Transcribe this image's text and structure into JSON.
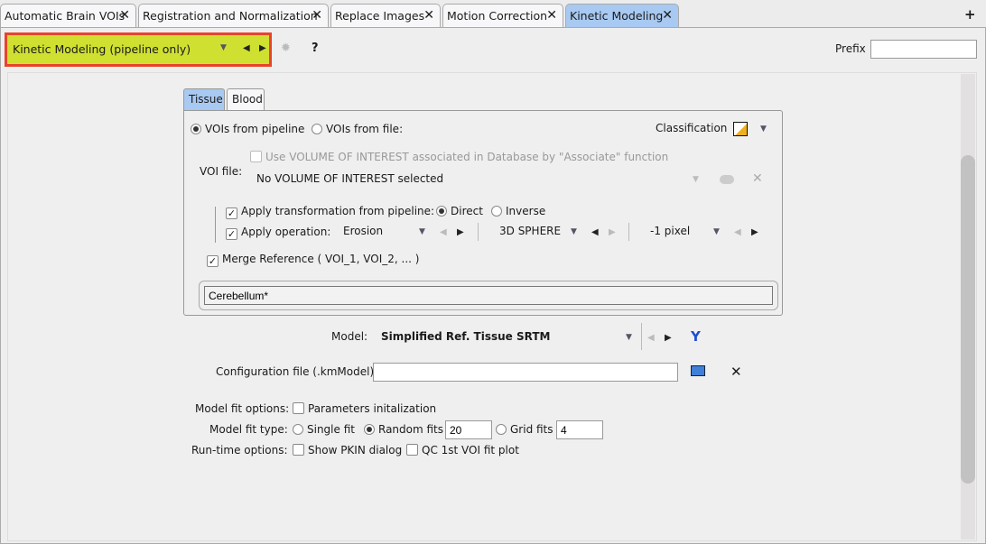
{
  "tabs": [
    {
      "label": "Automatic Brain VOIs",
      "active": false
    },
    {
      "label": "Registration and Normalization",
      "active": false
    },
    {
      "label": "Replace Images",
      "active": false
    },
    {
      "label": "Motion Correction",
      "active": false
    },
    {
      "label": "Kinetic Modeling",
      "active": true
    }
  ],
  "add_tab": "+",
  "toolbar": {
    "pipeline": "Kinetic Modeling (pipeline only)",
    "help": "?",
    "prefix_label": "Prefix",
    "prefix_value": "",
    "highlight_color": "#e8432a",
    "pipeline_bg": "#cfe030"
  },
  "subtabs": [
    "Tissue",
    "Blood"
  ],
  "tissue": {
    "vois_from_pipeline": "VOIs from pipeline",
    "vois_from_file": "VOIs from file:",
    "source": "pipeline",
    "classification": "Classification",
    "voi_file_label": "VOI file:",
    "use_associated": "Use VOLUME OF INTEREST associated in Database by \"Associate\" function",
    "voi_file_value": "No VOLUME OF INTEREST selected",
    "apply_transformation": "Apply transformation from pipeline:",
    "direct": "Direct",
    "inverse": "Inverse",
    "direction": "Direct",
    "apply_operation": "Apply operation:",
    "operation": "Erosion",
    "shape": "3D SPHERE",
    "size": "-1 pixel",
    "merge_reference": "Merge Reference ( VOI_1, VOI_2, ... )",
    "reference_value": "Cerebellum*"
  },
  "model": {
    "label": "Model:",
    "value": "Simplified Ref. Tissue SRTM"
  },
  "config": {
    "label": "Configuration file (.kmModel)",
    "value": ""
  },
  "fit_options": {
    "label": "Model fit options:",
    "params_init": "Parameters initalization"
  },
  "fit_type": {
    "label": "Model fit type:",
    "single": "Single fit",
    "random": "Random fits",
    "random_value": "20",
    "grid": "Grid fits",
    "grid_value": "4",
    "selected": "Random fits"
  },
  "runtime": {
    "label": "Run-time options:",
    "show_pkin": "Show PKIN dialog",
    "qc_plot": "QC 1st VOI fit plot"
  }
}
